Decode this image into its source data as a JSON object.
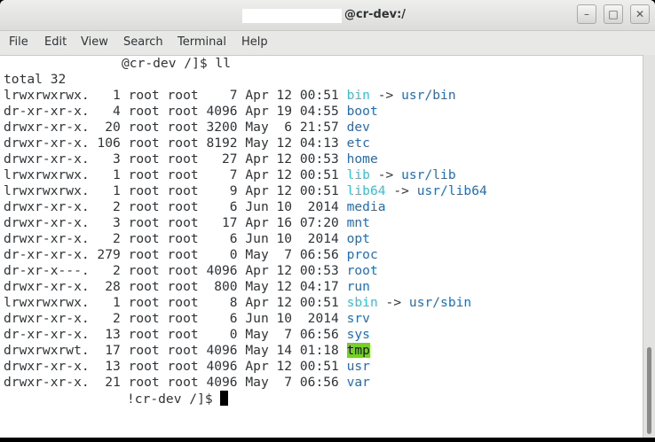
{
  "window": {
    "title": "@cr-dev:/",
    "controls": {
      "minimize": "–",
      "maximize": "□",
      "close": "✕"
    }
  },
  "menu": [
    "File",
    "Edit",
    "View",
    "Search",
    "Terminal",
    "Help"
  ],
  "terminal": {
    "prompt1": "@cr-dev /]$ ll",
    "total": "total 32",
    "rows": [
      {
        "perms": "lrwxrwxrwx.",
        "links": "1",
        "owner": "root",
        "group": "root",
        "size": "7",
        "month": "Apr",
        "day": "12",
        "time": "00:51",
        "name": "bin",
        "arrow": "->",
        "target": "usr/bin",
        "style": "link"
      },
      {
        "perms": "dr-xr-xr-x.",
        "links": "4",
        "owner": "root",
        "group": "root",
        "size": "4096",
        "month": "Apr",
        "day": "19",
        "time": "04:55",
        "name": "boot",
        "style": "dir"
      },
      {
        "perms": "drwxr-xr-x.",
        "links": "20",
        "owner": "root",
        "group": "root",
        "size": "3200",
        "month": "May",
        "day": "6",
        "time": "21:57",
        "name": "dev",
        "style": "dir"
      },
      {
        "perms": "drwxr-xr-x.",
        "links": "106",
        "owner": "root",
        "group": "root",
        "size": "8192",
        "month": "May",
        "day": "12",
        "time": "04:13",
        "name": "etc",
        "style": "dir"
      },
      {
        "perms": "drwxr-xr-x.",
        "links": "3",
        "owner": "root",
        "group": "root",
        "size": "27",
        "month": "Apr",
        "day": "12",
        "time": "00:53",
        "name": "home",
        "style": "dir"
      },
      {
        "perms": "lrwxrwxrwx.",
        "links": "1",
        "owner": "root",
        "group": "root",
        "size": "7",
        "month": "Apr",
        "day": "12",
        "time": "00:51",
        "name": "lib",
        "arrow": "->",
        "target": "usr/lib",
        "style": "link"
      },
      {
        "perms": "lrwxrwxrwx.",
        "links": "1",
        "owner": "root",
        "group": "root",
        "size": "9",
        "month": "Apr",
        "day": "12",
        "time": "00:51",
        "name": "lib64",
        "arrow": "->",
        "target": "usr/lib64",
        "style": "link"
      },
      {
        "perms": "drwxr-xr-x.",
        "links": "2",
        "owner": "root",
        "group": "root",
        "size": "6",
        "month": "Jun",
        "day": "10",
        "time": "2014",
        "name": "media",
        "style": "dir"
      },
      {
        "perms": "drwxr-xr-x.",
        "links": "3",
        "owner": "root",
        "group": "root",
        "size": "17",
        "month": "Apr",
        "day": "16",
        "time": "07:20",
        "name": "mnt",
        "style": "dir"
      },
      {
        "perms": "drwxr-xr-x.",
        "links": "2",
        "owner": "root",
        "group": "root",
        "size": "6",
        "month": "Jun",
        "day": "10",
        "time": "2014",
        "name": "opt",
        "style": "dir"
      },
      {
        "perms": "dr-xr-xr-x.",
        "links": "279",
        "owner": "root",
        "group": "root",
        "size": "0",
        "month": "May",
        "day": "7",
        "time": "06:56",
        "name": "proc",
        "style": "dir"
      },
      {
        "perms": "dr-xr-x---.",
        "links": "2",
        "owner": "root",
        "group": "root",
        "size": "4096",
        "month": "Apr",
        "day": "12",
        "time": "00:53",
        "name": "root",
        "style": "dir"
      },
      {
        "perms": "drwxr-xr-x.",
        "links": "28",
        "owner": "root",
        "group": "root",
        "size": "800",
        "month": "May",
        "day": "12",
        "time": "04:17",
        "name": "run",
        "style": "dir"
      },
      {
        "perms": "lrwxrwxrwx.",
        "links": "1",
        "owner": "root",
        "group": "root",
        "size": "8",
        "month": "Apr",
        "day": "12",
        "time": "00:51",
        "name": "sbin",
        "arrow": "->",
        "target": "usr/sbin",
        "style": "link"
      },
      {
        "perms": "drwxr-xr-x.",
        "links": "2",
        "owner": "root",
        "group": "root",
        "size": "6",
        "month": "Jun",
        "day": "10",
        "time": "2014",
        "name": "srv",
        "style": "dir"
      },
      {
        "perms": "dr-xr-xr-x.",
        "links": "13",
        "owner": "root",
        "group": "root",
        "size": "0",
        "month": "May",
        "day": "7",
        "time": "06:56",
        "name": "sys",
        "style": "dir"
      },
      {
        "perms": "drwxrwxrwt.",
        "links": "17",
        "owner": "root",
        "group": "root",
        "size": "4096",
        "month": "May",
        "day": "14",
        "time": "01:18",
        "name": "tmp",
        "style": "sticky"
      },
      {
        "perms": "drwxr-xr-x.",
        "links": "13",
        "owner": "root",
        "group": "root",
        "size": "4096",
        "month": "Apr",
        "day": "12",
        "time": "00:51",
        "name": "usr",
        "style": "dir"
      },
      {
        "perms": "drwxr-xr-x.",
        "links": "21",
        "owner": "root",
        "group": "root",
        "size": "4096",
        "month": "May",
        "day": "7",
        "time": "06:56",
        "name": "var",
        "style": "dir"
      }
    ],
    "prompt2": "!cr-dev /]$ "
  },
  "colors": {
    "link": "#2ec4d6",
    "dir": "#1a6fc4",
    "sticky_bg": "#6fd61c"
  }
}
